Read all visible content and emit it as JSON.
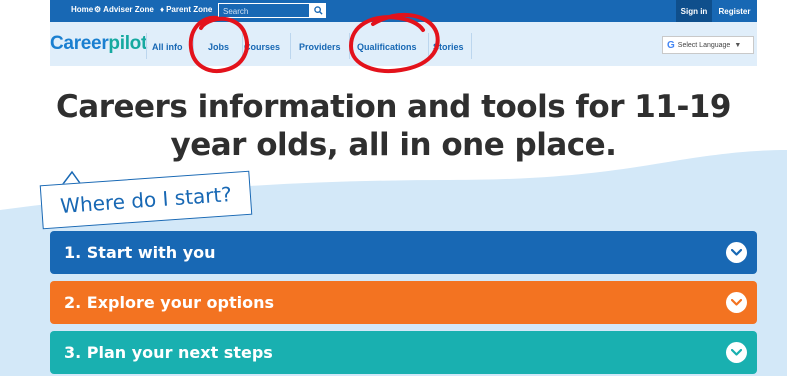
{
  "topbar": {
    "home": "Home",
    "adviser_zone": "Adviser Zone",
    "parent_zone": "Parent Zone",
    "search_placeholder": "Search",
    "sign_in": "Sign in",
    "register": "Register"
  },
  "nav": {
    "logo_career": "Career",
    "logo_pilot": "pilot",
    "items": [
      "All info",
      "Jobs",
      "Courses",
      "Providers",
      "Qualifications",
      "Stories"
    ],
    "language": "Select Language",
    "language_g": "G",
    "language_arrow": "▼"
  },
  "headline": {
    "line1": "Careers information and tools for 11-19",
    "line2": "year olds, all in one place."
  },
  "bubble": "Where do I start?",
  "accordion": [
    {
      "label": "1. Start with you",
      "color": "#1868b4"
    },
    {
      "label": "2. Explore your options",
      "color": "#f37321"
    },
    {
      "label": "3. Plan your next steps",
      "color": "#19b0b0"
    }
  ],
  "colors": {
    "brand_blue": "#1868b4",
    "nav_bg": "#e0eefa",
    "annotation_red": "#e3121b"
  },
  "icons": {
    "adviser": "gear-icon",
    "parent": "person-icon",
    "search": "search-icon",
    "accordion": "chevron-down-icon"
  }
}
